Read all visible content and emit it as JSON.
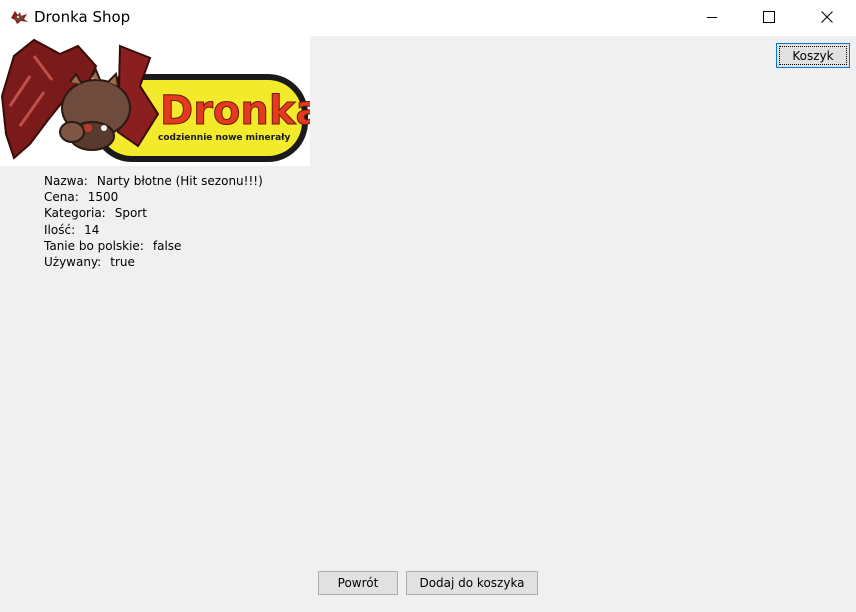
{
  "window": {
    "title": "Dronka Shop",
    "icon": "dronka-dragon-icon",
    "controls": [
      "minimize-icon",
      "maximize-icon",
      "close-icon"
    ]
  },
  "logo": {
    "text": "Dronka",
    "tagline": "codziennie nowe minerały",
    "colors": {
      "badge": "#f2ea2a",
      "text": "#e53a1e",
      "frame": "#1a1a1a"
    }
  },
  "cart_button": {
    "label": "Koszyk"
  },
  "product": {
    "fields": [
      {
        "label": "Nazwa:",
        "value": "Narty błotne (Hit sezonu!!!)"
      },
      {
        "label": "Cena:",
        "value": "1500"
      },
      {
        "label": "Kategoria:",
        "value": "Sport"
      },
      {
        "label": "Ilość:",
        "value": "14"
      },
      {
        "label": "Tanie bo polskie:",
        "value": "false"
      },
      {
        "label": "Używany:",
        "value": "true"
      }
    ]
  },
  "actions": {
    "back_label": "Powrót",
    "add_to_cart_label": "Dodaj do koszyka"
  },
  "colors": {
    "window_bg": "#f0f0f0",
    "focus_border": "#0078d7"
  }
}
